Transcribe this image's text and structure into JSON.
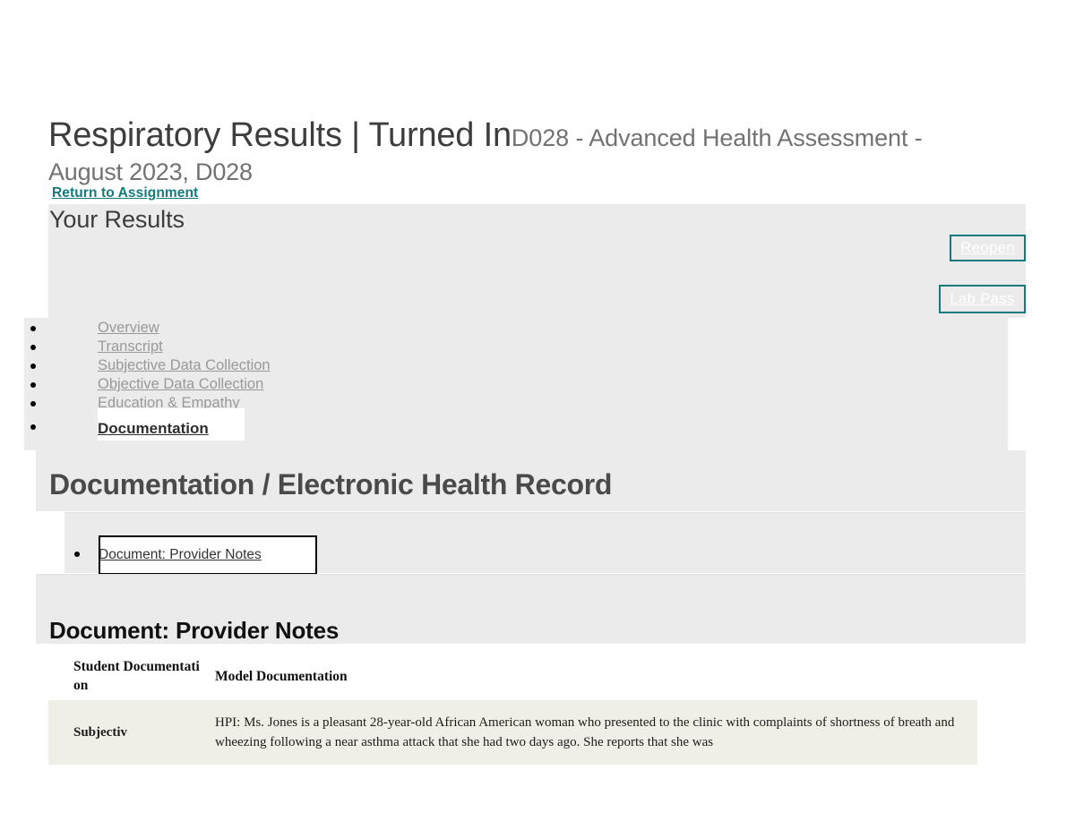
{
  "header": {
    "title_main": "Respiratory Results | Turned In",
    "title_sub": "D028 - Advanced Health Assessment - ",
    "title_sub2": "August 2023, D028",
    "return_link": "Return to Assignment"
  },
  "results": {
    "heading": "Your Results",
    "buttons": {
      "reopen": "Reopen",
      "lab_pass": "Lab Pass"
    }
  },
  "nav": {
    "items": [
      {
        "label": "Overview",
        "active": false
      },
      {
        "label": "Transcript",
        "active": false
      },
      {
        "label": "Subjective Data Collection",
        "active": false
      },
      {
        "label": "Objective Data Collection",
        "active": false
      },
      {
        "label": "Education & Empathy",
        "active": false
      },
      {
        "label": "Documentation",
        "active": true
      }
    ]
  },
  "documentation": {
    "section_heading": "Documentation / Electronic Health Record",
    "tabs": [
      {
        "label": "Document: Provider Notes",
        "active": true
      }
    ],
    "notes_heading": "Document: Provider Notes",
    "table": {
      "columns": [
        "Student Documentation",
        "Model Documentation"
      ],
      "rows": [
        {
          "label": "Subjectiv",
          "body": "HPI: Ms. Jones is a pleasant 28-year-old African American woman who presented to the clinic with complaints of shortness of breath and wheezing following a near asthma attack that she had two days ago. She reports that she was"
        }
      ]
    }
  },
  "colors": {
    "teal": "#147a7e",
    "panel_gray": "#ebebeb",
    "row_cream": "#f0efe7",
    "title_gray": "#3d3d3d",
    "muted_gray": "#999999"
  }
}
